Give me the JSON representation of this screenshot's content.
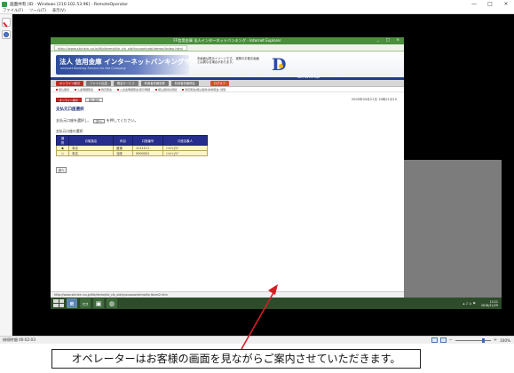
{
  "window": {
    "title": "画面共有 [ID - Windows [210.102.53.96] - RemoteOperator",
    "min": "—",
    "max": "□",
    "close": "×"
  },
  "menu": [
    "ファイル(F)",
    "ツール(T)",
    "表示(V)"
  ],
  "ie": {
    "title": "FF信用金庫 法人インターネットバンキング - Internet Explorer",
    "url": "http://www.shinkin.co.jp/tlb/demo/hb_cls_sid/tyouseiyobi/demo/index.html",
    "buttons": "_ □ ×",
    "status_url": "http://www.shinkin.co.jp/tlb/demo/hb_cls_sid/syousasa/demo/furikomi2.htm"
  },
  "banner": {
    "logo_main": "法人 信用金庫 インターネットバンキングサービス",
    "logo_sub": "Internet Banking Service for the Company",
    "notice": "本画面は表示イメージです。 実際のお取引画面とは異なる場合があります。",
    "stripe": "Demo Service Page"
  },
  "nav": [
    "オンライン取引",
    "ファイル伝送",
    "照会サービス",
    "利用者情報変更",
    "利用者情報照会",
    "ログオフ"
  ],
  "subnav": [
    "振込振替",
    "入金明細照会",
    "残高照会",
    "入出金明細照会/取引明細",
    "振込振替先登録",
    "残高照会(振込振替/請求照会) 閲覧"
  ],
  "content": {
    "crumbs": [
      "オンライン取引",
      "振込振替"
    ],
    "datetime": "2005年05月21日 15時21分10",
    "page_title": "支払元口座選択",
    "instr_before": "支払元口座を選択し、",
    "instr_button": "次へ",
    "instr_after": "を押してください。",
    "table_label": "支払元口座の選択",
    "table_headers": [
      "選択",
      "お取扱店",
      "科目",
      "口座番号",
      "口座名義人"
    ],
    "rows": [
      {
        "radio": "◉",
        "branch": "本店",
        "type": "普通",
        "number": "1111111",
        "holder": "ｼﾝｷﾝｼｮｳｼﾞ"
      },
      {
        "radio": "○",
        "branch": "本店",
        "type": "当座",
        "number": "0000001",
        "holder": "ｼﾝｷﾝｼｮｳｼﾞ"
      }
    ],
    "next_button": "次へ"
  },
  "taskbar": {
    "tray": "▴ ♪ ⌂ ⚑",
    "time": "15:21",
    "date": "2016/11/29"
  },
  "statusbar": {
    "connection": "接続時間 00:02:03",
    "zoom": "100%",
    "zoom_minus": "−",
    "zoom_plus": "+"
  },
  "caption": "オペレーターはお客様の画面を見ながらご案内させていただきます。",
  "colors": {
    "ie_green": "#4a8f3c",
    "nav_red": "#c42a2a",
    "table_header": "#262d8c",
    "annotation_red": "#d71e24"
  }
}
